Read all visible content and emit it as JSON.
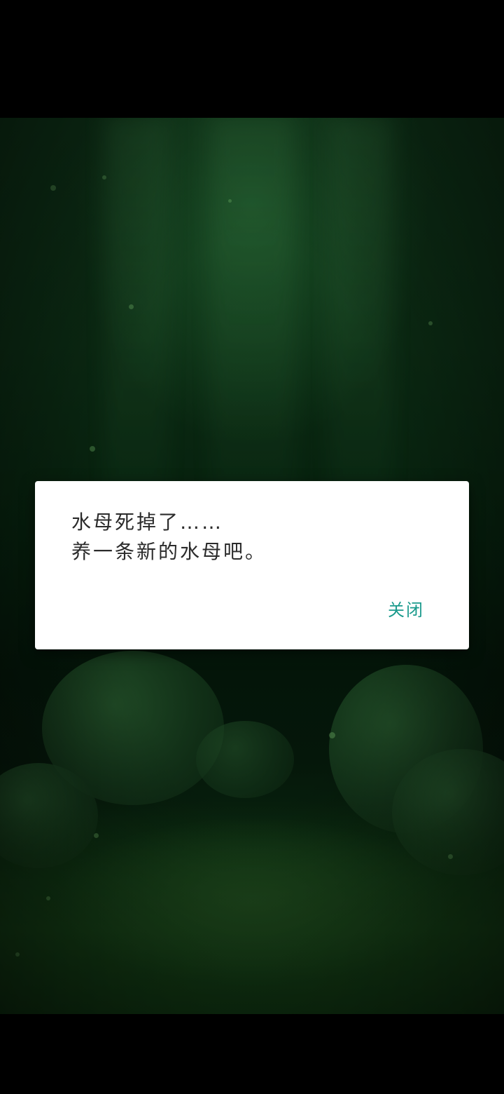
{
  "dialog": {
    "message_line1": "水母死掉了……",
    "message_line2": "养一条新的水母吧。",
    "close_label": "关闭"
  },
  "colors": {
    "dialog_background": "#ffffff",
    "message_text": "#2b2b2b",
    "close_button_text": "#1a9a8c",
    "scene_tint": "#0b2a13"
  }
}
